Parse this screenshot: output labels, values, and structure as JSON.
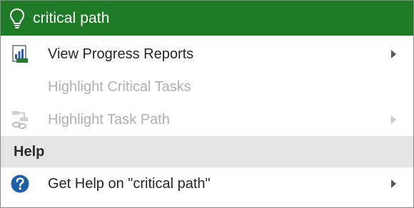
{
  "search": {
    "query": "critical path",
    "icon": "lightbulb-icon"
  },
  "menu": {
    "items": [
      {
        "label": "View Progress Reports",
        "icon": "report-chart-icon",
        "enabled": true,
        "has_submenu": true
      },
      {
        "label": "Highlight Critical Tasks",
        "icon": "",
        "enabled": false,
        "has_submenu": false
      },
      {
        "label": "Highlight Task Path",
        "icon": "task-path-icon",
        "enabled": false,
        "has_submenu": true
      }
    ]
  },
  "help": {
    "header": "Help",
    "item": {
      "label": "Get Help on \"critical path\"",
      "icon": "help-question-icon",
      "has_submenu": true
    }
  },
  "colors": {
    "accent_green": "#1e7b26",
    "help_blue": "#1b5faa",
    "disabled_text": "#b0b0b0",
    "section_bg": "#e4e4e4"
  }
}
